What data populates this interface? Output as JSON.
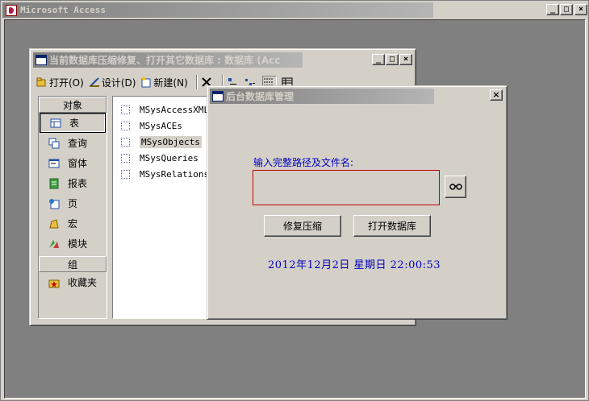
{
  "app": {
    "title": "Microsoft Access",
    "controls": {
      "minimize": "_",
      "maximize": "□",
      "close": "×"
    }
  },
  "db_window": {
    "title": "当前数据库压缩修复、打开其它数据库 : 数据库 (Acc",
    "toolbar": {
      "open": "打开(O)",
      "design": "设计(D)",
      "new": "新建(N)"
    },
    "objects_group": {
      "header": "对象",
      "items": [
        "表",
        "查询",
        "窗体",
        "报表",
        "页",
        "宏",
        "模块"
      ],
      "selected": "表"
    },
    "groups_group": {
      "header": "组",
      "items": [
        "收藏夹"
      ]
    },
    "table_list": [
      "MSysAccessXML",
      "MSysACEs",
      "MSysObjects",
      "MSysQueries",
      "MSysRelationships"
    ],
    "selected_table": "MSysObjects"
  },
  "dialog": {
    "title": "后台数据库管理",
    "path_label": "输入完整路径及文件名:",
    "path_value": "",
    "repair_button": "修复压缩",
    "open_button": "打开数据库",
    "datetime": "2012年12月2日  星期日  22:00:53",
    "accent_color": "#0000c0"
  }
}
